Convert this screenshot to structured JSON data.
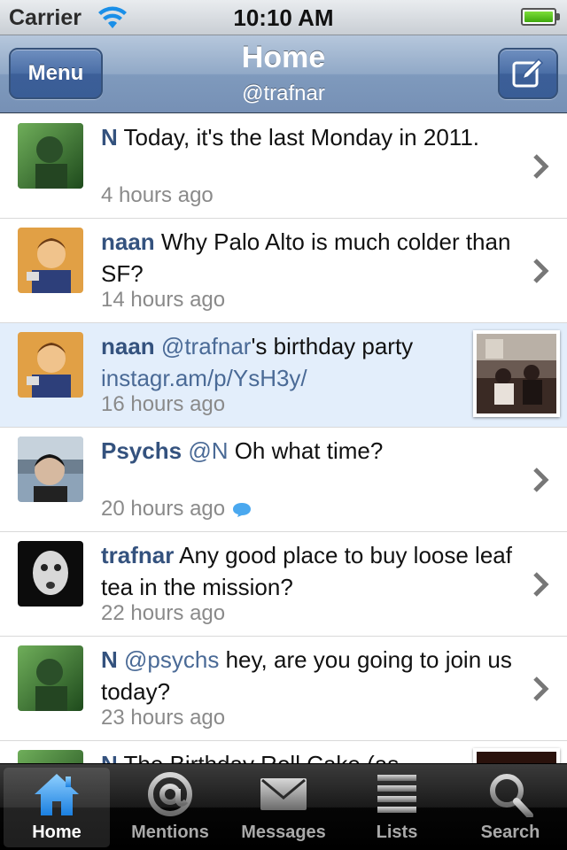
{
  "status_bar": {
    "carrier": "Carrier",
    "time": "10:10 AM"
  },
  "nav_bar": {
    "menu_label": "Menu",
    "title": "Home",
    "subtitle": "@trafnar"
  },
  "timeline": [
    {
      "author": "N",
      "mention": "",
      "text": "Today, it's the last Monday in 2011.",
      "link": "",
      "time": "4 hours ago",
      "avatar": "n-avatar",
      "selected": false,
      "has_thumb": false,
      "has_reply_icon": false
    },
    {
      "author": "naan",
      "mention": "",
      "text": "Why Palo Alto is much colder than SF?",
      "link": "",
      "time": "14 hours ago",
      "avatar": "naan-avatar",
      "selected": false,
      "has_thumb": false,
      "has_reply_icon": false
    },
    {
      "author": "naan",
      "mention": "@trafnar",
      "text": "'s birthday party",
      "link": "instagr.am/p/YsH3y/",
      "time": "16 hours ago",
      "avatar": "naan-avatar",
      "selected": true,
      "has_thumb": true,
      "has_reply_icon": false
    },
    {
      "author": "Psychs",
      "mention": "@N",
      "text": " Oh what time?",
      "link": "",
      "time": "20 hours ago",
      "avatar": "psychs-avatar",
      "selected": false,
      "has_thumb": false,
      "has_reply_icon": true
    },
    {
      "author": "trafnar",
      "mention": "",
      "text": "Any good place to buy loose leaf tea in the mission?",
      "link": "",
      "time": "22 hours ago",
      "avatar": "trafnar-avatar",
      "selected": false,
      "has_thumb": false,
      "has_reply_icon": false
    },
    {
      "author": "N",
      "mention": "@psychs",
      "text": " hey, are you going to join us today?",
      "link": "",
      "time": "23 hours ago",
      "avatar": "n-avatar",
      "selected": false,
      "has_thumb": false,
      "has_reply_icon": false
    },
    {
      "author": "N",
      "mention": "",
      "text": "The Birthday Roll Cake (as",
      "link": "",
      "time": "",
      "avatar": "n-avatar",
      "selected": false,
      "has_thumb": true,
      "has_reply_icon": false
    }
  ],
  "tab_bar": {
    "active": "home",
    "tabs": [
      {
        "id": "home",
        "label": "Home",
        "icon": "home-icon"
      },
      {
        "id": "mentions",
        "label": "Mentions",
        "icon": "at-icon"
      },
      {
        "id": "messages",
        "label": "Messages",
        "icon": "envelope-icon"
      },
      {
        "id": "lists",
        "label": "Lists",
        "icon": "list-icon"
      },
      {
        "id": "search",
        "label": "Search",
        "icon": "search-icon"
      }
    ]
  },
  "colors": {
    "author": "#34527e",
    "link": "#4a6a96",
    "selected_row": "#e3eefb",
    "timestamp": "#8a8a8a",
    "nav_bar": "#7f9abd"
  }
}
